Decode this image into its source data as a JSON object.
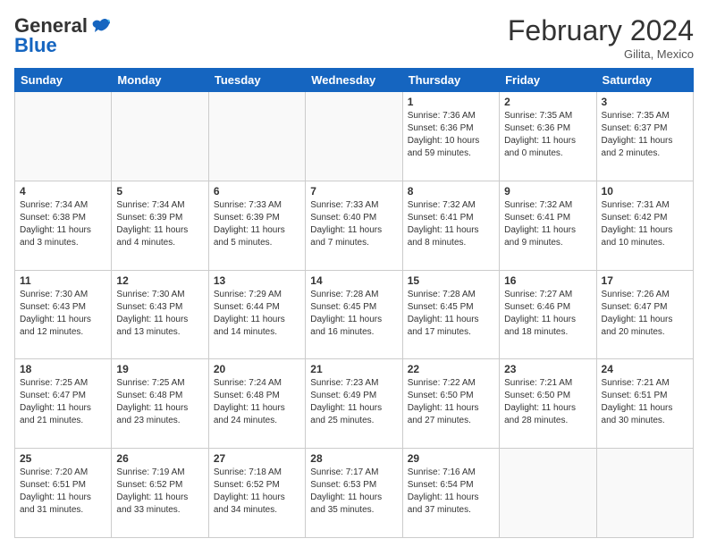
{
  "header": {
    "logo_general": "General",
    "logo_blue": "Blue",
    "month_title": "February 2024",
    "location": "Gilita, Mexico"
  },
  "days_of_week": [
    "Sunday",
    "Monday",
    "Tuesday",
    "Wednesday",
    "Thursday",
    "Friday",
    "Saturday"
  ],
  "weeks": [
    [
      {
        "day": "",
        "info": ""
      },
      {
        "day": "",
        "info": ""
      },
      {
        "day": "",
        "info": ""
      },
      {
        "day": "",
        "info": ""
      },
      {
        "day": "1",
        "info": "Sunrise: 7:36 AM\nSunset: 6:36 PM\nDaylight: 10 hours and 59 minutes."
      },
      {
        "day": "2",
        "info": "Sunrise: 7:35 AM\nSunset: 6:36 PM\nDaylight: 11 hours and 0 minutes."
      },
      {
        "day": "3",
        "info": "Sunrise: 7:35 AM\nSunset: 6:37 PM\nDaylight: 11 hours and 2 minutes."
      }
    ],
    [
      {
        "day": "4",
        "info": "Sunrise: 7:34 AM\nSunset: 6:38 PM\nDaylight: 11 hours and 3 minutes."
      },
      {
        "day": "5",
        "info": "Sunrise: 7:34 AM\nSunset: 6:39 PM\nDaylight: 11 hours and 4 minutes."
      },
      {
        "day": "6",
        "info": "Sunrise: 7:33 AM\nSunset: 6:39 PM\nDaylight: 11 hours and 5 minutes."
      },
      {
        "day": "7",
        "info": "Sunrise: 7:33 AM\nSunset: 6:40 PM\nDaylight: 11 hours and 7 minutes."
      },
      {
        "day": "8",
        "info": "Sunrise: 7:32 AM\nSunset: 6:41 PM\nDaylight: 11 hours and 8 minutes."
      },
      {
        "day": "9",
        "info": "Sunrise: 7:32 AM\nSunset: 6:41 PM\nDaylight: 11 hours and 9 minutes."
      },
      {
        "day": "10",
        "info": "Sunrise: 7:31 AM\nSunset: 6:42 PM\nDaylight: 11 hours and 10 minutes."
      }
    ],
    [
      {
        "day": "11",
        "info": "Sunrise: 7:30 AM\nSunset: 6:43 PM\nDaylight: 11 hours and 12 minutes."
      },
      {
        "day": "12",
        "info": "Sunrise: 7:30 AM\nSunset: 6:43 PM\nDaylight: 11 hours and 13 minutes."
      },
      {
        "day": "13",
        "info": "Sunrise: 7:29 AM\nSunset: 6:44 PM\nDaylight: 11 hours and 14 minutes."
      },
      {
        "day": "14",
        "info": "Sunrise: 7:28 AM\nSunset: 6:45 PM\nDaylight: 11 hours and 16 minutes."
      },
      {
        "day": "15",
        "info": "Sunrise: 7:28 AM\nSunset: 6:45 PM\nDaylight: 11 hours and 17 minutes."
      },
      {
        "day": "16",
        "info": "Sunrise: 7:27 AM\nSunset: 6:46 PM\nDaylight: 11 hours and 18 minutes."
      },
      {
        "day": "17",
        "info": "Sunrise: 7:26 AM\nSunset: 6:47 PM\nDaylight: 11 hours and 20 minutes."
      }
    ],
    [
      {
        "day": "18",
        "info": "Sunrise: 7:25 AM\nSunset: 6:47 PM\nDaylight: 11 hours and 21 minutes."
      },
      {
        "day": "19",
        "info": "Sunrise: 7:25 AM\nSunset: 6:48 PM\nDaylight: 11 hours and 23 minutes."
      },
      {
        "day": "20",
        "info": "Sunrise: 7:24 AM\nSunset: 6:48 PM\nDaylight: 11 hours and 24 minutes."
      },
      {
        "day": "21",
        "info": "Sunrise: 7:23 AM\nSunset: 6:49 PM\nDaylight: 11 hours and 25 minutes."
      },
      {
        "day": "22",
        "info": "Sunrise: 7:22 AM\nSunset: 6:50 PM\nDaylight: 11 hours and 27 minutes."
      },
      {
        "day": "23",
        "info": "Sunrise: 7:21 AM\nSunset: 6:50 PM\nDaylight: 11 hours and 28 minutes."
      },
      {
        "day": "24",
        "info": "Sunrise: 7:21 AM\nSunset: 6:51 PM\nDaylight: 11 hours and 30 minutes."
      }
    ],
    [
      {
        "day": "25",
        "info": "Sunrise: 7:20 AM\nSunset: 6:51 PM\nDaylight: 11 hours and 31 minutes."
      },
      {
        "day": "26",
        "info": "Sunrise: 7:19 AM\nSunset: 6:52 PM\nDaylight: 11 hours and 33 minutes."
      },
      {
        "day": "27",
        "info": "Sunrise: 7:18 AM\nSunset: 6:52 PM\nDaylight: 11 hours and 34 minutes."
      },
      {
        "day": "28",
        "info": "Sunrise: 7:17 AM\nSunset: 6:53 PM\nDaylight: 11 hours and 35 minutes."
      },
      {
        "day": "29",
        "info": "Sunrise: 7:16 AM\nSunset: 6:54 PM\nDaylight: 11 hours and 37 minutes."
      },
      {
        "day": "",
        "info": ""
      },
      {
        "day": "",
        "info": ""
      }
    ]
  ]
}
